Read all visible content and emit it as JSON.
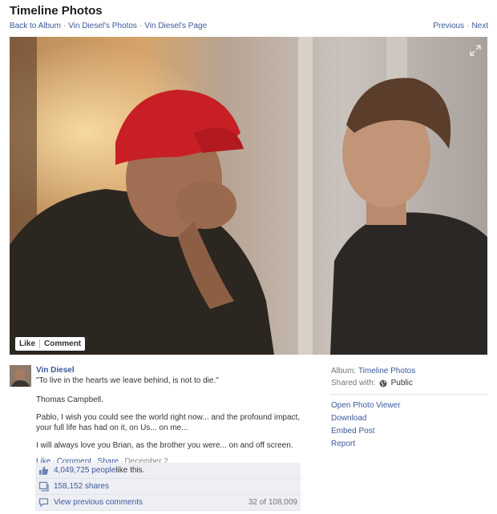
{
  "page": {
    "title": "Timeline Photos"
  },
  "breadcrumb": [
    "Back to Album",
    "Vin Diesel's Photos",
    "Vin Diesel's Page"
  ],
  "breadcrumb_sep": "·",
  "pager": {
    "previous": "Previous",
    "next": "Next"
  },
  "photo_actions": {
    "like": "Like",
    "comment": "Comment"
  },
  "post": {
    "author": "Vin Diesel",
    "quote": "\"To live in the hearts we leave behind, is not to die.\"",
    "attribution": "Thomas Campbell.",
    "paragraph1": "Pablo, I wish you could see the world right now... and the profound impact, your full life has had on it, on Us... on me...",
    "paragraph2": "I will always love you Brian, as the brother you were... on and off screen.",
    "actions": {
      "like": "Like",
      "comment": "Comment",
      "share": "Share"
    },
    "date": "December 2",
    "sep": "·"
  },
  "stats": {
    "likes_count": "4,049,725 people",
    "likes_suffix": " like this.",
    "shares": "158,152 shares",
    "view_comments": "View previous comments",
    "comments_count": "32 of 108,009"
  },
  "sidebar": {
    "album_label": "Album:",
    "album_name": "Timeline Photos",
    "shared_label": "Shared with:",
    "shared_value": "Public",
    "actions": [
      "Open Photo Viewer",
      "Download",
      "Embed Post",
      "Report"
    ]
  },
  "colors": {
    "link": "#3b5998",
    "stats_bg": "#edeff4"
  }
}
